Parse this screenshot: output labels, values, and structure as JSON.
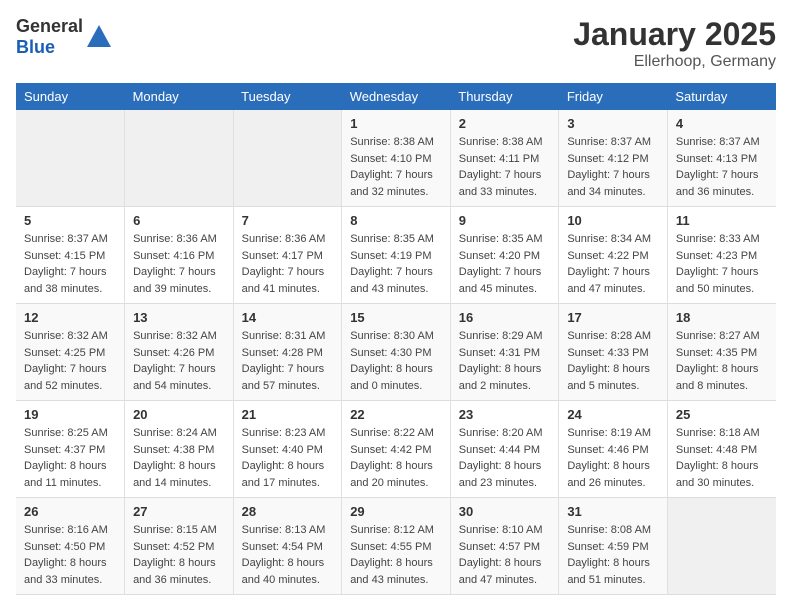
{
  "header": {
    "logo_general": "General",
    "logo_blue": "Blue",
    "title": "January 2025",
    "subtitle": "Ellerhoop, Germany"
  },
  "weekdays": [
    "Sunday",
    "Monday",
    "Tuesday",
    "Wednesday",
    "Thursday",
    "Friday",
    "Saturday"
  ],
  "weeks": [
    {
      "days": [
        {
          "empty": true
        },
        {
          "empty": true
        },
        {
          "empty": true
        },
        {
          "num": "1",
          "sunrise": "8:38 AM",
          "sunset": "4:10 PM",
          "daylight": "7 hours and 32 minutes."
        },
        {
          "num": "2",
          "sunrise": "8:38 AM",
          "sunset": "4:11 PM",
          "daylight": "7 hours and 33 minutes."
        },
        {
          "num": "3",
          "sunrise": "8:37 AM",
          "sunset": "4:12 PM",
          "daylight": "7 hours and 34 minutes."
        },
        {
          "num": "4",
          "sunrise": "8:37 AM",
          "sunset": "4:13 PM",
          "daylight": "7 hours and 36 minutes."
        }
      ]
    },
    {
      "days": [
        {
          "num": "5",
          "sunrise": "8:37 AM",
          "sunset": "4:15 PM",
          "daylight": "7 hours and 38 minutes."
        },
        {
          "num": "6",
          "sunrise": "8:36 AM",
          "sunset": "4:16 PM",
          "daylight": "7 hours and 39 minutes."
        },
        {
          "num": "7",
          "sunrise": "8:36 AM",
          "sunset": "4:17 PM",
          "daylight": "7 hours and 41 minutes."
        },
        {
          "num": "8",
          "sunrise": "8:35 AM",
          "sunset": "4:19 PM",
          "daylight": "7 hours and 43 minutes."
        },
        {
          "num": "9",
          "sunrise": "8:35 AM",
          "sunset": "4:20 PM",
          "daylight": "7 hours and 45 minutes."
        },
        {
          "num": "10",
          "sunrise": "8:34 AM",
          "sunset": "4:22 PM",
          "daylight": "7 hours and 47 minutes."
        },
        {
          "num": "11",
          "sunrise": "8:33 AM",
          "sunset": "4:23 PM",
          "daylight": "7 hours and 50 minutes."
        }
      ]
    },
    {
      "days": [
        {
          "num": "12",
          "sunrise": "8:32 AM",
          "sunset": "4:25 PM",
          "daylight": "7 hours and 52 minutes."
        },
        {
          "num": "13",
          "sunrise": "8:32 AM",
          "sunset": "4:26 PM",
          "daylight": "7 hours and 54 minutes."
        },
        {
          "num": "14",
          "sunrise": "8:31 AM",
          "sunset": "4:28 PM",
          "daylight": "7 hours and 57 minutes."
        },
        {
          "num": "15",
          "sunrise": "8:30 AM",
          "sunset": "4:30 PM",
          "daylight": "8 hours and 0 minutes."
        },
        {
          "num": "16",
          "sunrise": "8:29 AM",
          "sunset": "4:31 PM",
          "daylight": "8 hours and 2 minutes."
        },
        {
          "num": "17",
          "sunrise": "8:28 AM",
          "sunset": "4:33 PM",
          "daylight": "8 hours and 5 minutes."
        },
        {
          "num": "18",
          "sunrise": "8:27 AM",
          "sunset": "4:35 PM",
          "daylight": "8 hours and 8 minutes."
        }
      ]
    },
    {
      "days": [
        {
          "num": "19",
          "sunrise": "8:25 AM",
          "sunset": "4:37 PM",
          "daylight": "8 hours and 11 minutes."
        },
        {
          "num": "20",
          "sunrise": "8:24 AM",
          "sunset": "4:38 PM",
          "daylight": "8 hours and 14 minutes."
        },
        {
          "num": "21",
          "sunrise": "8:23 AM",
          "sunset": "4:40 PM",
          "daylight": "8 hours and 17 minutes."
        },
        {
          "num": "22",
          "sunrise": "8:22 AM",
          "sunset": "4:42 PM",
          "daylight": "8 hours and 20 minutes."
        },
        {
          "num": "23",
          "sunrise": "8:20 AM",
          "sunset": "4:44 PM",
          "daylight": "8 hours and 23 minutes."
        },
        {
          "num": "24",
          "sunrise": "8:19 AM",
          "sunset": "4:46 PM",
          "daylight": "8 hours and 26 minutes."
        },
        {
          "num": "25",
          "sunrise": "8:18 AM",
          "sunset": "4:48 PM",
          "daylight": "8 hours and 30 minutes."
        }
      ]
    },
    {
      "days": [
        {
          "num": "26",
          "sunrise": "8:16 AM",
          "sunset": "4:50 PM",
          "daylight": "8 hours and 33 minutes."
        },
        {
          "num": "27",
          "sunrise": "8:15 AM",
          "sunset": "4:52 PM",
          "daylight": "8 hours and 36 minutes."
        },
        {
          "num": "28",
          "sunrise": "8:13 AM",
          "sunset": "4:54 PM",
          "daylight": "8 hours and 40 minutes."
        },
        {
          "num": "29",
          "sunrise": "8:12 AM",
          "sunset": "4:55 PM",
          "daylight": "8 hours and 43 minutes."
        },
        {
          "num": "30",
          "sunrise": "8:10 AM",
          "sunset": "4:57 PM",
          "daylight": "8 hours and 47 minutes."
        },
        {
          "num": "31",
          "sunrise": "8:08 AM",
          "sunset": "4:59 PM",
          "daylight": "8 hours and 51 minutes."
        },
        {
          "empty": true
        }
      ]
    }
  ],
  "labels": {
    "sunrise": "Sunrise:",
    "sunset": "Sunset:",
    "daylight": "Daylight:"
  }
}
